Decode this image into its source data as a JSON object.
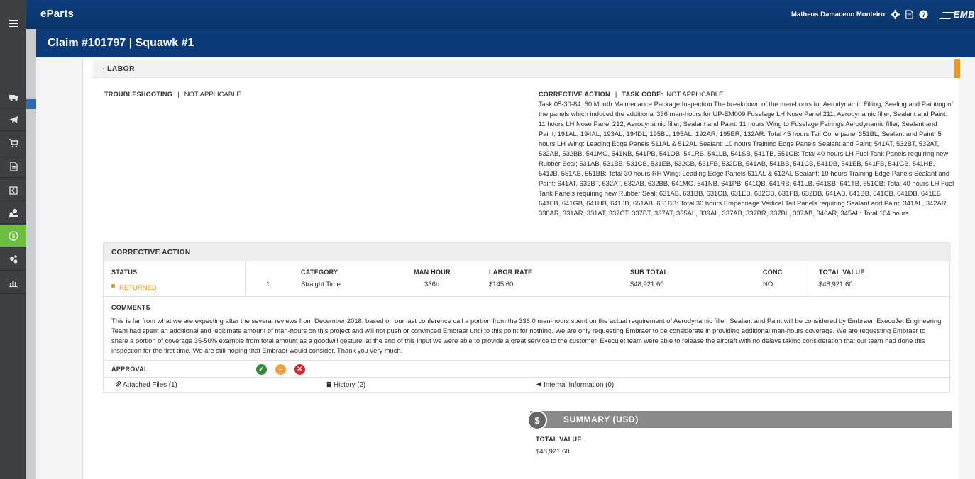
{
  "app": {
    "brand": "eParts",
    "user_name": "Matheus Damaceno Monteiro",
    "logo_text": "EMB"
  },
  "page": {
    "title": "Claim #101797 | Squawk #1"
  },
  "labor": {
    "section_label": "- LABOR",
    "troubleshooting_label": "TROUBLESHOOTING",
    "troubleshooting_value": "NOT APPLICABLE",
    "corrective_action_label": "CORRECTIVE ACTION",
    "task_code_label": "TASK CODE:",
    "task_code_value": "NOT APPLICABLE",
    "corrective_action_text": "Task 05-30-84: 60 Month Maintenance Package Inspection The breakdown of the man-hours for Aerodynamic Filling, Sealing and Painting of the panels which induced the additional 336 man-hours for UP-EM009 Fuselage LH Nose Panel 211, Aerodynamic filler, Sealant and Paint: 11 hours LH Nose Panel 212, Aerodynamic filler, Sealant and Paint: 11 hours Wing to Fuselage Fairings Aerodynamic filler, Sealant and Paint; 191AL, 194AL, 193AL, 194DL, 195BL, 195AL, 192AR, 195ER, 132AR: Total 45 hours Tail Cone panel 351BL, Sealant and Paint: 5 hours LH Wing: Leading Edge Panels 511AL & 512AL Sealant: 10 hours Training Edge Panels Sealant and Paint; 541AT, 532BT, 532AT, 532AB, 532BB, 541MG, 541NB, 541PB, 541QB, 541RB, 541LB, 541SB, 541TB, 551CB: Total 40 hours LH Fuel Tank Panels requiring new Rubber Seal; 531AB, 531BB, 531CB, 531EB, 532CB, 531FB, 532DB, 541AB, 541BB, 541CB, 541DB, 541EB, 541FB, 541GB, 541HB, 541JB, 551AB, 551BB: Total 30 hours RH Wing: Leading Edge Panels 611AL & 612AL Sealant: 10 hours Training Edge Panels Sealant and Paint; 641AT, 632BT, 632AT, 632AB, 632BB, 641MG, 641NB, 641PB, 641QB, 641RB, 641LB, 641SB, 641TB, 651CB: Total 40 hours LH Fuel Tank Panels requiring new Rubber Seal; 631AB, 631BB, 631CB, 631EB, 632CB, 631FB, 632DB, 641AB, 641BB, 641CB, 641DB, 641EB, 641FB, 641GB, 641HB, 641JB, 651AB, 651BB: Total 30 hours Empennage Vertical Tail Panels requiring Sealant and Paint; 341AL, 342AR, 338AR, 331AR, 331AT, 337CT, 337BT, 337AT, 335AL, 339AL, 337AB, 337BR, 337BL, 337AB, 346AR, 345AL: Total 104 hours"
  },
  "corrective_action": {
    "header": "CORRECTIVE ACTION",
    "status_label": "STATUS",
    "status_value": "RETURNED",
    "row_number": "1",
    "category_label": "CATEGORY",
    "category_value": "Straight Time",
    "man_hour_label": "MAN HOUR",
    "man_hour_value": "336h",
    "labor_rate_label": "LABOR RATE",
    "labor_rate_value": "$145.60",
    "sub_total_label": "SUB TOTAL",
    "sub_total_value": "$48,921.60",
    "conc_label": "CONC",
    "conc_value": "NO",
    "total_value_label": "TOTAL VALUE",
    "total_value_value": "$48,921.60",
    "comments_label": "COMMENTS",
    "comments_text": "This is far from what we are expecting after the several reviews from December 2018, based on our last conference call a portion from the 336.0 man-hours spent on the actual requirement of Aerodynamic filler, Sealant and Paint will be considered by Embraer. ExecuJet Engineering Team had spent an additional and legitimate amount of man-hours on this project and will not push or convinced Embraer until to this point for nothing. We are only requesting Embraer to be considerate in providing additional man-hours coverage. We are requesting Embraer to share a portion of coverage 35-50% example from total amount as a goodwill gesture, at the end of this input we were able to provide a great service to the customer. Execujet team were able to release the aircraft with no delays taking consideration that our team had done this inspection for the first time. We are still hoping that Embraer would consider. Thank you very much.",
    "approval_label": "APPROVAL",
    "attached_files": "Attached Files (1)",
    "history": "History (2)",
    "internal_info": "Internal Information (0)"
  },
  "summary": {
    "title": "SUMMARY (USD)",
    "badge": "$",
    "total_label": "TOTAL VALUE",
    "total_value": "$48,921.60"
  },
  "colors": {
    "header_blue": "#0a3a77",
    "accent_orange": "#f7941d",
    "active_green": "#6cbf3e",
    "approve_green": "#2e8b3a",
    "partial_orange": "#f0a040",
    "reject_red": "#d9262c"
  }
}
